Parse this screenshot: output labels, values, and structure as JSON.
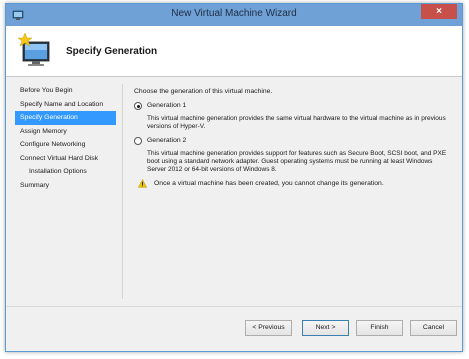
{
  "window": {
    "title": "New Virtual Machine Wizard",
    "close_label": "×"
  },
  "header": {
    "title": "Specify Generation"
  },
  "nav": {
    "items": [
      {
        "label": "Before You Begin"
      },
      {
        "label": "Specify Name and Location"
      },
      {
        "label": "Specify Generation"
      },
      {
        "label": "Assign Memory"
      },
      {
        "label": "Configure Networking"
      },
      {
        "label": "Connect Virtual Hard Disk"
      },
      {
        "label": "Installation Options"
      },
      {
        "label": "Summary"
      }
    ]
  },
  "content": {
    "intro": "Choose the generation of this virtual machine.",
    "options": [
      {
        "label": "Generation 1",
        "checked": true,
        "description": "This virtual machine generation provides the same virtual hardware to the virtual machine as in previous versions of Hyper-V."
      },
      {
        "label": "Generation 2",
        "checked": false,
        "description": "This virtual machine generation provides support for features such as Secure Boot, SCSI boot, and PXE boot using a standard network adapter. Guest operating systems must be running at least Windows Server 2012 or 64-bit versions of Windows 8."
      }
    ],
    "warning": "Once a virtual machine has been created, you cannot change its generation."
  },
  "buttons": {
    "previous": "< Previous",
    "next": "Next >",
    "finish": "Finish",
    "cancel": "Cancel"
  },
  "colors": {
    "titlebar": "#6fa0d6",
    "active_nav": "#3399ff",
    "close": "#c7504a"
  }
}
